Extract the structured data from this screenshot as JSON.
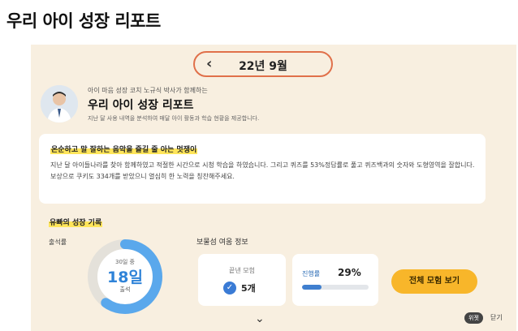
{
  "page": {
    "title": "우리 아이 성장 리포트"
  },
  "month": {
    "prev_icon": "‹",
    "label": "22년 9월"
  },
  "coach": {
    "subtitle": "아이 마음 성장 코치 노규식 박사가 함께하는",
    "title": "우리 아이 성장 리포트",
    "description": "지난 달 사용 내역을 분석하여 매달 아이 활동과 학습 현황을 제공합니다."
  },
  "message": {
    "headline": "온순하고 말 잘하는 음악을 즐길 줄 아는 멋쟁이",
    "body": "지난 달 아이들나라를 찾아 함께하였고 적절한 시간으로 시청 학습을 하였습니다. 그리고 퀴즈를 53%정답률로 풀고 퀴즈백과의 숫자와 도형영역을 잘합니다. 보상으로 쿠키도 334개를 받았으니 열심히 한 노력을 칭찬해주세요."
  },
  "growth": {
    "section_title": "유빠의 성장 기록",
    "attendance_label": "출석률",
    "attendance_days_total": 30,
    "attendance_days": 18,
    "donut_top": "30일 중",
    "donut_value": "18일",
    "donut_sub": "출석",
    "info_label": "보물섬 여움 정보",
    "completed_label": "끝낸 모험",
    "completed_value": "5개",
    "progress_label": "진행률",
    "progress_value": "29%",
    "progress_fraction": 0.29,
    "cta_label": "전체 모험 보기"
  },
  "footer": {
    "expand_icon": "⌄",
    "hide_chip": "위젯",
    "close_label": "닫기"
  },
  "colors": {
    "accent": "#e0704a",
    "panel": "#f8efe0",
    "blue": "#2f83d8",
    "cta": "#f8b62a",
    "highlight": "#ffe55a"
  }
}
